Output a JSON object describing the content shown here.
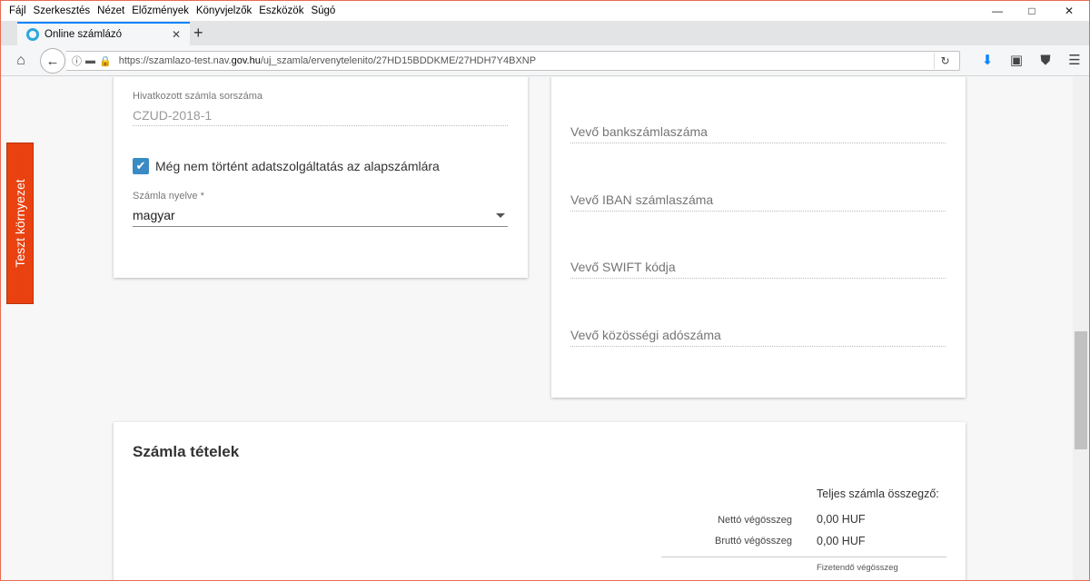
{
  "menu": [
    "Fájl",
    "Szerkesztés",
    "Nézet",
    "Előzmények",
    "Könyvjelzők",
    "Eszközök",
    "Súgó"
  ],
  "tab": {
    "title": "Online számlázó"
  },
  "url": {
    "prefix": "https://szamlazo-test.nav.",
    "domain": "gov.hu",
    "path": "/uj_szamla/ervenytelenito/27HD15BDDKME/27HDH7Y4BXNP"
  },
  "side_tab": "Teszt környezet",
  "left_card": {
    "ref_label": "Hivatkozott számla sorszáma",
    "ref_value": "CZUD-2018-1",
    "checkbox_label": "Még nem történt adatszolgáltatás az alapszámlára",
    "checkbox_checked": true,
    "language_label": "Számla nyelve *",
    "language_value": "magyar"
  },
  "right_card": {
    "bank_account": "Vevő bankszámlaszáma",
    "iban": "Vevő IBAN számlaszáma",
    "swift": "Vevő SWIFT kódja",
    "community_tax": "Vevő közösségi adószáma"
  },
  "items": {
    "title": "Számla tételek",
    "summary_header": "Teljes számla összegző:",
    "net_label": "Nettó végösszeg",
    "net_value": "0,00 HUF",
    "gross_label": "Bruttó végösszeg",
    "gross_value": "0,00 HUF",
    "payable_label": "Fizetendő végösszeg"
  },
  "colors": {
    "accent": "#0a84ff",
    "test_env": "#e94210",
    "checkbox": "#3a8bc4"
  }
}
